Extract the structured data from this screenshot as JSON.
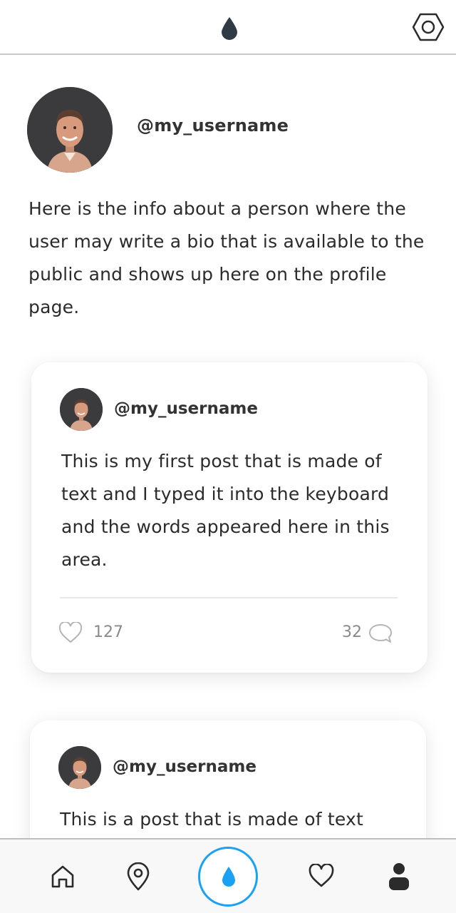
{
  "header": {
    "logo_icon": "drop-icon",
    "settings_icon": "hexagon-settings-icon"
  },
  "profile": {
    "username": "@my_username",
    "bio": "Here is the info about a person where the user may write a bio that is available to the public and shows up here on the profile page."
  },
  "posts": [
    {
      "username": "@my_username",
      "text": "This is my first post that is made of text and I typed it into the keyboard and the words appeared here in this area.",
      "likes": "127",
      "comments": "32"
    },
    {
      "username": "@my_username",
      "text": "This is a post that is made of text"
    }
  ],
  "bottom_nav": {
    "items": [
      "home-icon",
      "map-pin-icon",
      "drop-icon",
      "heart-icon",
      "person-icon"
    ],
    "accent_color": "#1ba1f2"
  }
}
